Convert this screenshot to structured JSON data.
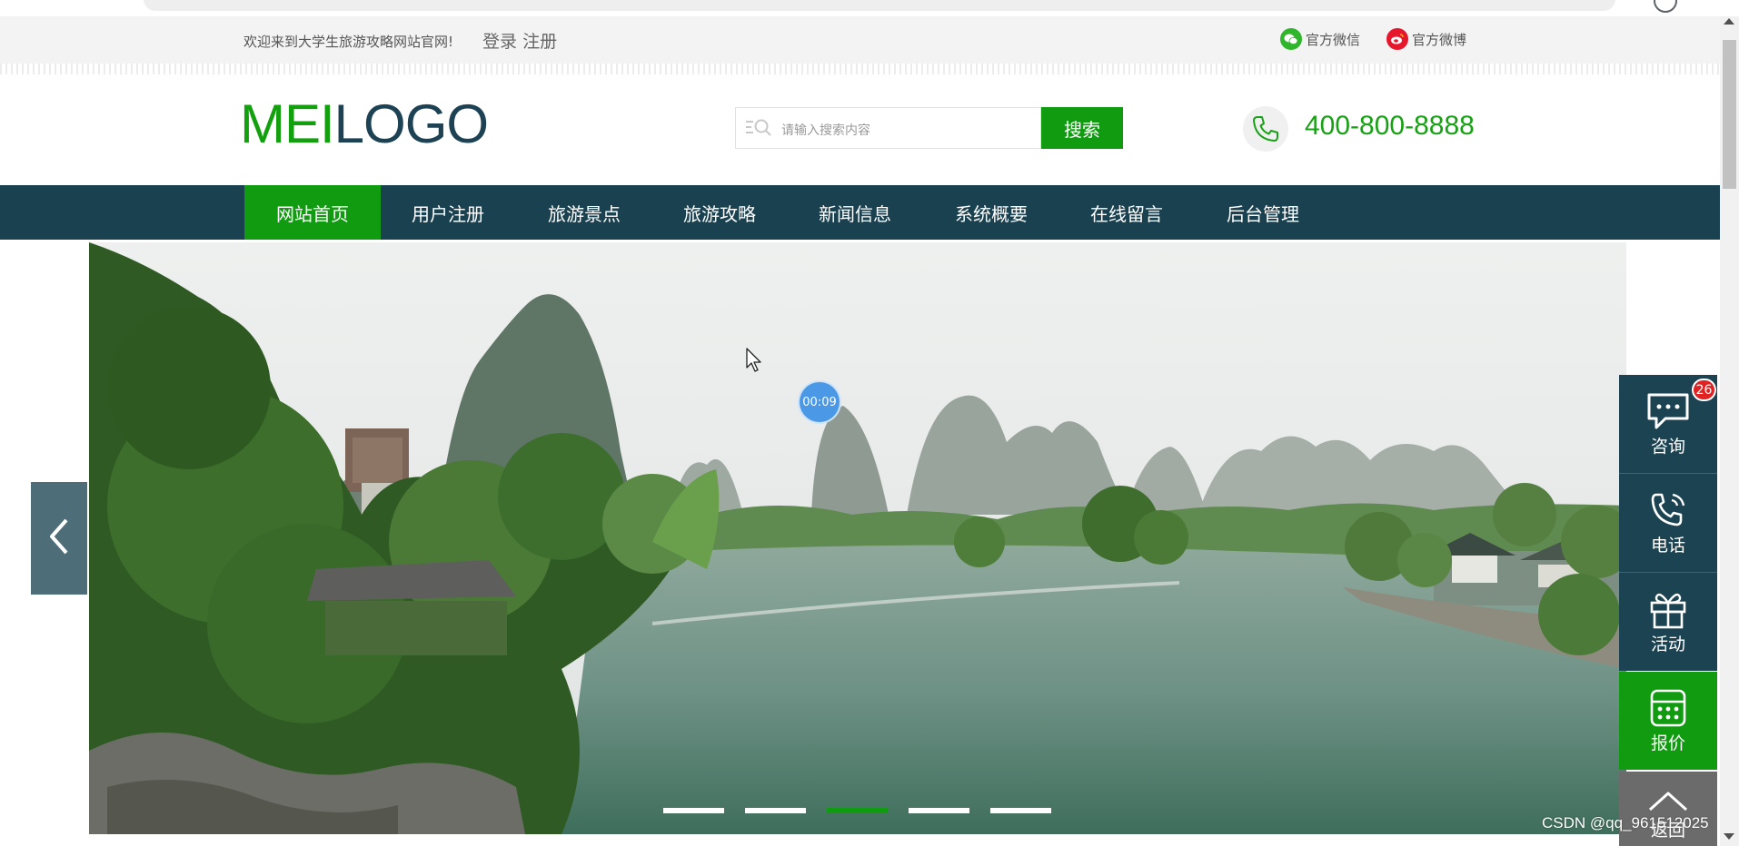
{
  "topbar": {
    "welcome": "欢迎来到大学生旅游攻略网站官网!",
    "login": "登录",
    "register": "注册",
    "wechat": "官方微信",
    "weibo": "官方微博"
  },
  "header": {
    "logo_part1": "MEI",
    "logo_part2": "LOGO",
    "search_placeholder": "请输入搜索内容",
    "search_button": "搜索",
    "phone": "400-800-8888"
  },
  "nav": {
    "items": [
      "网站首页",
      "用户注册",
      "旅游景点",
      "旅游攻略",
      "新闻信息",
      "系统概要",
      "在线留言",
      "后台管理"
    ],
    "active_index": 0
  },
  "banner": {
    "timer": "00:09",
    "slide_count": 5,
    "active_slide": 2
  },
  "sidebar": {
    "consult": "咨询",
    "consult_badge": "26",
    "phone": "电话",
    "activity": "活动",
    "quote": "报价",
    "back": "返回"
  },
  "watermark": "CSDN @qq_961512025",
  "colors": {
    "brand_green": "#119b10",
    "nav_dark": "#1a4150",
    "sidebar_dark": "#1c4352",
    "badge_red": "#e02222"
  },
  "icons": [
    "wechat-icon",
    "weibo-icon",
    "search-icon",
    "phone-icon",
    "chevron-left-icon",
    "chat-icon",
    "phone-call-icon",
    "gift-icon",
    "calculator-icon",
    "chevron-up-icon"
  ]
}
